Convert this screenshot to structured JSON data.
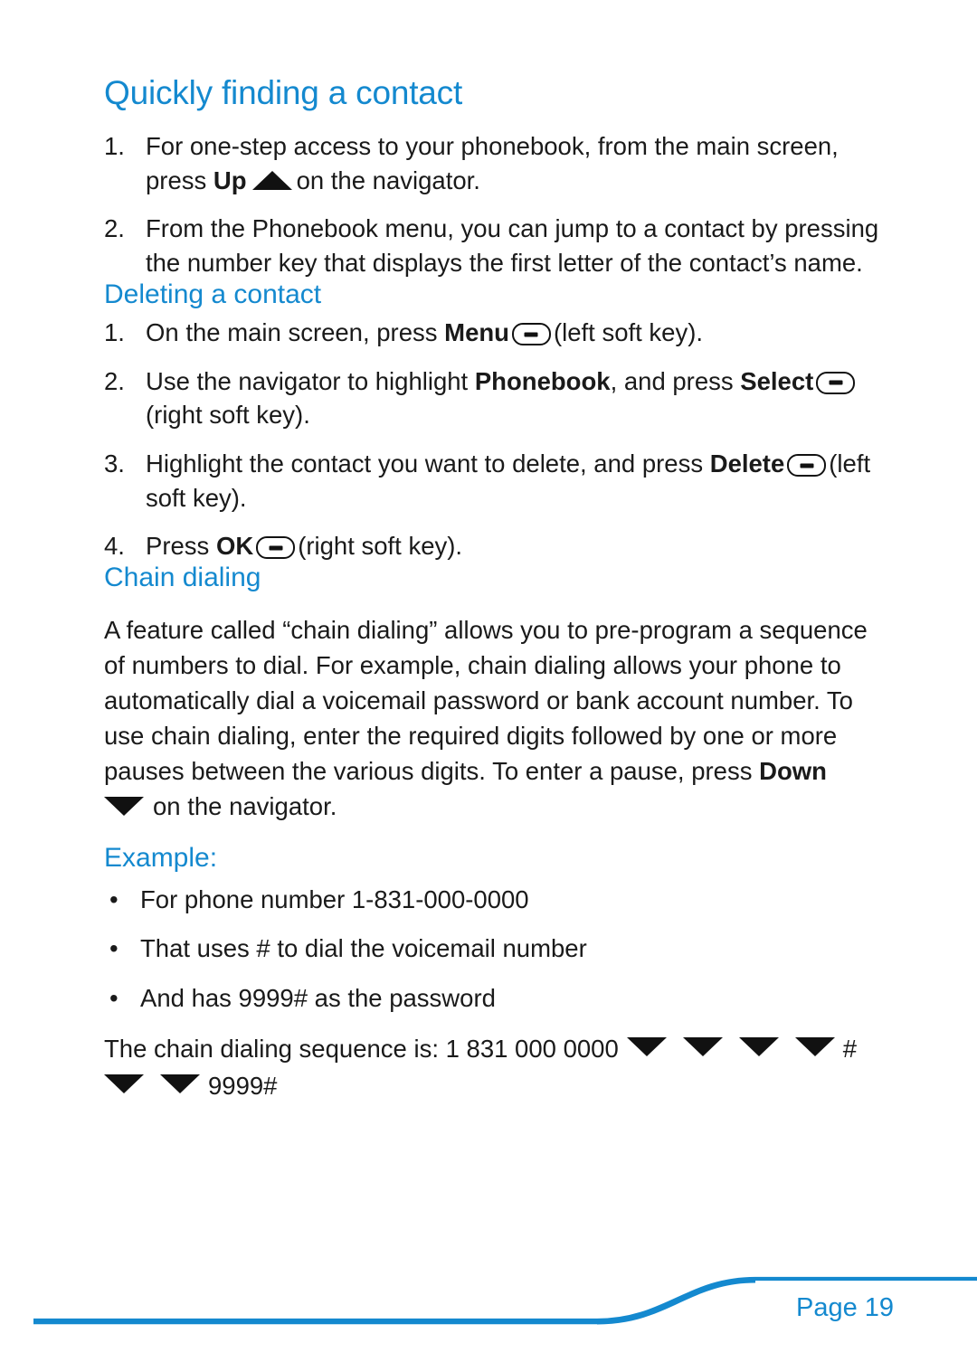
{
  "document": {
    "page_label": "Page 19",
    "accent_color": "#1489cf",
    "text_color": "#1a1a1a"
  },
  "sections": [
    {
      "id": "quickly-finding-a-contact",
      "heading": "Quickly finding a contact",
      "steps": [
        {
          "number": "1.",
          "parts": [
            {
              "type": "text",
              "value": "For one-step access to your phonebook, from the main screen, press "
            },
            {
              "type": "bold",
              "value": "Up"
            },
            {
              "type": "icon",
              "value": "nav-up-arrow-icon"
            },
            {
              "type": "text",
              "value": "on the navigator."
            }
          ]
        },
        {
          "number": "2.",
          "parts": [
            {
              "type": "text",
              "value": "From the Phonebook menu, you can jump to a contact by pressing the number key that displays the first letter of the contact’s name."
            }
          ]
        }
      ]
    },
    {
      "id": "deleting-a-contact",
      "heading": "Deleting a contact",
      "steps": [
        {
          "number": "1.",
          "parts": [
            {
              "type": "text",
              "value": "On the main screen, press "
            },
            {
              "type": "bold",
              "value": "Menu"
            },
            {
              "type": "icon",
              "value": "soft-key-icon"
            },
            {
              "type": "text",
              "value": "(left soft key)."
            }
          ]
        },
        {
          "number": "2.",
          "parts": [
            {
              "type": "text",
              "value": "Use the navigator to highlight "
            },
            {
              "type": "bold",
              "value": "Phonebook"
            },
            {
              "type": "text",
              "value": ", and press "
            },
            {
              "type": "bold",
              "value": "Select"
            },
            {
              "type": "icon",
              "value": "soft-key-icon"
            },
            {
              "type": "text",
              "value": "(right soft key)."
            }
          ]
        },
        {
          "number": "3.",
          "parts": [
            {
              "type": "text",
              "value": "Highlight the contact you want to delete, and press "
            },
            {
              "type": "bold",
              "value": "Delete"
            },
            {
              "type": "icon",
              "value": "soft-key-icon"
            },
            {
              "type": "text",
              "value": "(left soft key)."
            }
          ]
        },
        {
          "number": "4.",
          "parts": [
            {
              "type": "text",
              "value": "Press "
            },
            {
              "type": "bold",
              "value": "OK"
            },
            {
              "type": "icon",
              "value": "soft-key-icon"
            },
            {
              "type": "text",
              "value": "(right soft key)."
            }
          ]
        }
      ]
    },
    {
      "id": "chain-dialing",
      "heading": "Chain dialing",
      "paragraph_part_1": "A feature called “chain dialing” allows you to pre-program a sequence of numbers to dial. For example, chain dialing allows your phone to automatically dial a voicemail password or bank account number. To use chain dialing, enter the required digits followed by one or more pauses between the various digits. To enter a pause, press ",
      "paragraph_bold": "Down",
      "paragraph_part_2": "on the navigator.",
      "example_heading": "Example:",
      "bullets": [
        "For phone number 1-831-000-0000",
        "That uses # to dial the voicemail number",
        "And has 9999# as the password"
      ],
      "sequence": {
        "lead_text": "The chain dialing sequence is: 1 831 000 0000",
        "hash_after_pauses": "#",
        "pauses_first_group": 4,
        "pauses_second_group": 2,
        "password": "9999#"
      }
    }
  ],
  "icons": {
    "nav_up": "nav-up-arrow-icon",
    "nav_down": "nav-down-arrow-icon",
    "soft_key": "soft-key-icon",
    "bullet": "•"
  }
}
